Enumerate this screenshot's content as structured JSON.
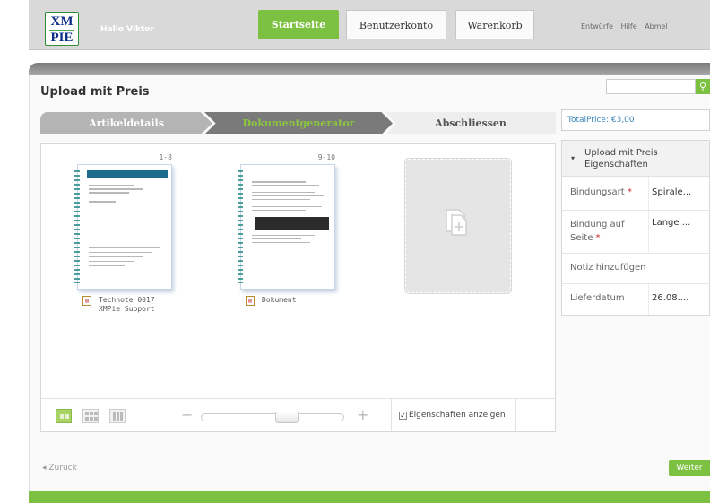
{
  "header": {
    "logo_line1": "XM",
    "logo_line2": "PIE",
    "greeting": "Hallo Viktor",
    "nav": [
      "Startseite",
      "Benutzerkonto",
      "Warenkorb"
    ],
    "links": [
      "Entwürfe",
      "Hilfe",
      "Abmel"
    ]
  },
  "page": {
    "title": "Upload mit Preis"
  },
  "search": {
    "placeholder": "",
    "button_icon": "search-icon"
  },
  "steps": [
    "Artikeldetails",
    "Dokumentgenerator",
    "Abschliessen"
  ],
  "documents": [
    {
      "range": "1-8",
      "line1": "Technote 0017",
      "line2": "XMPie Support"
    },
    {
      "range": "9-10",
      "line1": "Dokument",
      "line2": ""
    }
  ],
  "toolbar": {
    "minus": "−",
    "plus": "+",
    "show_properties": "Eigenschaften anzeigen",
    "zoom_level": 0.62
  },
  "total": {
    "text": "TotalPrice: €3,00"
  },
  "properties": {
    "header_line1": "Upload mit Preis",
    "header_line2": "Eigenschaften",
    "rows": [
      {
        "key": "Bindungsart",
        "required": "*",
        "value": "Spirale..."
      },
      {
        "key": "Bindung auf",
        "key2": "Seite",
        "required": "*",
        "value": "Lange ..."
      },
      {
        "key": "Notiz hinzufügen",
        "value": ""
      },
      {
        "key": "Lieferdatum",
        "value": "26.08...."
      }
    ]
  },
  "footer": {
    "back": "◂ Zurück",
    "next": "Weiter"
  },
  "colors": {
    "accent": "#7cc142",
    "dark_step": "#7a7a7a",
    "link": "#3a85b8"
  }
}
